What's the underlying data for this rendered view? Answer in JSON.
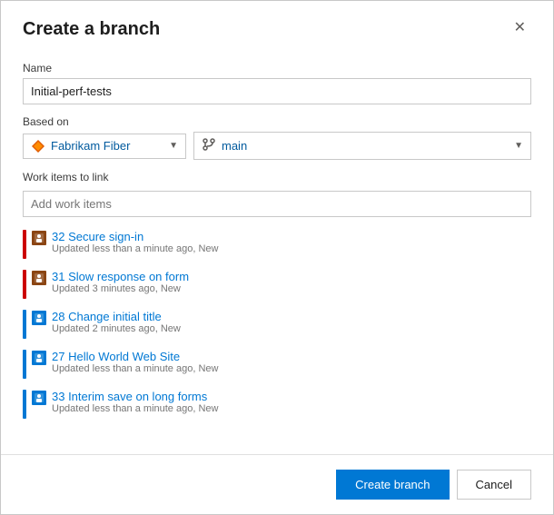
{
  "dialog": {
    "title": "Create a branch",
    "close_label": "✕"
  },
  "form": {
    "name_label": "Name",
    "name_value": "Initial-perf-tests",
    "based_on_label": "Based on",
    "repo_name": "Fabrikam Fiber",
    "branch_name": "main",
    "work_items_label": "Work items to link",
    "work_items_placeholder": "Add work items"
  },
  "work_items": [
    {
      "id": "32",
      "title": "Secure sign-in",
      "meta": "Updated less than a minute ago, New",
      "color": "#cc0000",
      "icon_color": "#8b4513"
    },
    {
      "id": "31",
      "title": "Slow response on form",
      "meta": "Updated 3 minutes ago, New",
      "color": "#cc0000",
      "icon_color": "#8b4513"
    },
    {
      "id": "28",
      "title": "Change initial title",
      "meta": "Updated 2 minutes ago, New",
      "color": "#0078d4",
      "icon_color": "#0078d4"
    },
    {
      "id": "27",
      "title": "Hello World Web Site",
      "meta": "Updated less than a minute ago, New",
      "color": "#0078d4",
      "icon_color": "#0078d4"
    },
    {
      "id": "33",
      "title": "Interim save on long forms",
      "meta": "Updated less than a minute ago, New",
      "color": "#0078d4",
      "icon_color": "#0078d4"
    }
  ],
  "footer": {
    "create_label": "Create branch",
    "cancel_label": "Cancel"
  }
}
